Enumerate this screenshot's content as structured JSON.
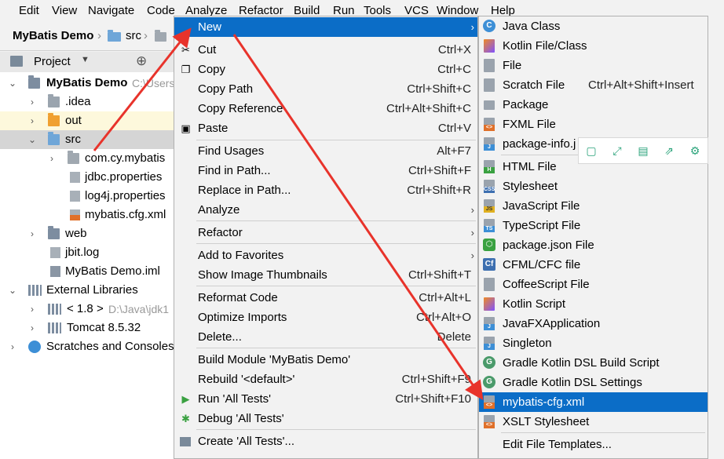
{
  "menubar": [
    "Edit",
    "View",
    "Navigate",
    "Code",
    "Analyze",
    "Refactor",
    "Build",
    "Run",
    "Tools",
    "VCS",
    "Window",
    "Help"
  ],
  "navbar": {
    "project": "MyBatis Demo",
    "crumb": "src"
  },
  "project_panel": {
    "title": "Project"
  },
  "tree": {
    "root": {
      "name": "MyBatis Demo",
      "path": "C:\\Users"
    },
    "idea": ".idea",
    "out": "out",
    "src": "src",
    "pkg": "com.cy.mybatis",
    "jdbc": "jdbc.properties",
    "log4j": "log4j.properties",
    "mybatis": "mybatis.cfg.xml",
    "web": "web",
    "jbit": "jbit.log",
    "iml": "MyBatis Demo.iml",
    "extlibs": "External Libraries",
    "jdk": "< 1.8 >",
    "jdk_path": "D:\\Java\\jdk1",
    "tomcat": "Tomcat 8.5.32",
    "scratches": "Scratches and Consoles"
  },
  "context_menu": {
    "new": "New",
    "cut": {
      "label": "Cut",
      "shortcut": "Ctrl+X"
    },
    "copy": {
      "label": "Copy",
      "shortcut": "Ctrl+C"
    },
    "copy_path": {
      "label": "Copy Path",
      "shortcut": "Ctrl+Shift+C"
    },
    "copy_ref": {
      "label": "Copy Reference",
      "shortcut": "Ctrl+Alt+Shift+C"
    },
    "paste": {
      "label": "Paste",
      "shortcut": "Ctrl+V"
    },
    "find_usages": {
      "label": "Find Usages",
      "shortcut": "Alt+F7"
    },
    "find_in_path": {
      "label": "Find in Path...",
      "shortcut": "Ctrl+Shift+F"
    },
    "replace_in_path": {
      "label": "Replace in Path...",
      "shortcut": "Ctrl+Shift+R"
    },
    "analyze": "Analyze",
    "refactor": "Refactor",
    "add_fav": "Add to Favorites",
    "show_thumbs": {
      "label": "Show Image Thumbnails",
      "shortcut": "Ctrl+Shift+T"
    },
    "reformat": {
      "label": "Reformat Code",
      "shortcut": "Ctrl+Alt+L"
    },
    "optimize": {
      "label": "Optimize Imports",
      "shortcut": "Ctrl+Alt+O"
    },
    "delete": {
      "label": "Delete...",
      "shortcut": "Delete"
    },
    "build_module": "Build Module 'MyBatis Demo'",
    "rebuild": {
      "label": "Rebuild '<default>'",
      "shortcut": "Ctrl+Shift+F9"
    },
    "run": {
      "label": "Run 'All Tests'",
      "shortcut": "Ctrl+Shift+F10"
    },
    "debug": "Debug 'All Tests'",
    "create": "Create 'All Tests'..."
  },
  "new_submenu": {
    "java_class": "Java Class",
    "kotlin_file": "Kotlin File/Class",
    "file": "File",
    "scratch": {
      "label": "Scratch File",
      "shortcut": "Ctrl+Alt+Shift+Insert"
    },
    "package": "Package",
    "fxml": "FXML File",
    "package_info": "package-info.j",
    "html": "HTML File",
    "stylesheet": "Stylesheet",
    "js": "JavaScript File",
    "ts": "TypeScript File",
    "package_json": "package.json File",
    "cfml": "CFML/CFC file",
    "coffee": "CoffeeScript File",
    "kotlin_script": "Kotlin Script",
    "javafx": "JavaFXApplication",
    "singleton": "Singleton",
    "gradle_build": "Gradle Kotlin DSL Build Script",
    "gradle_settings": "Gradle Kotlin DSL Settings",
    "mybatis_cfg": "mybatis-cfg.xml",
    "xslt": "XSLT Stylesheet",
    "edit_templates": "Edit File Templates..."
  },
  "icons": {
    "tag_js": "JS",
    "tag_ts": "TS",
    "tag_css": "CSS",
    "tag_h": "H",
    "tag_j": "J",
    "tag_xml": "<>",
    "tag_c": "C",
    "tag_g": "G",
    "tag_cf": "Cf"
  },
  "colors": {
    "accent": "#0b6dc7",
    "annotation": "#e8332b",
    "floatbar_icon": "#2aa37a"
  }
}
